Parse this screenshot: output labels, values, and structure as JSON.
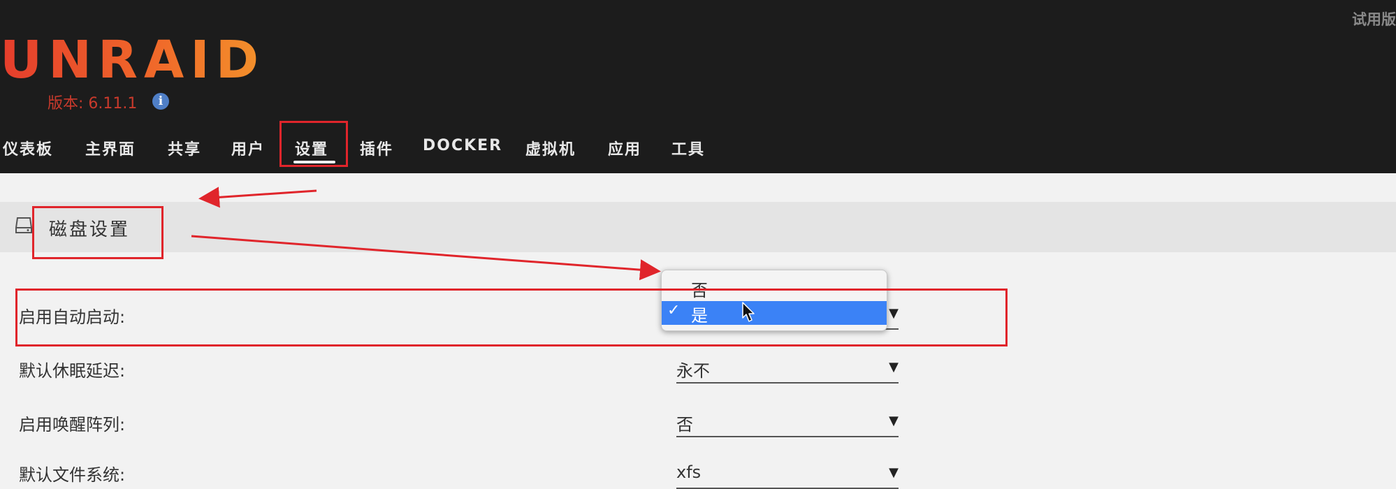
{
  "header": {
    "trial_label": "试用版",
    "logo_text": "UNRAID",
    "version": "版本: 6.11.1"
  },
  "nav": {
    "items": [
      {
        "label": "仪表板"
      },
      {
        "label": "主界面"
      },
      {
        "label": "共享"
      },
      {
        "label": "用户"
      },
      {
        "label": "设置",
        "active": true
      },
      {
        "label": "插件"
      },
      {
        "label": "DOCKER"
      },
      {
        "label": "虚拟机"
      },
      {
        "label": "应用"
      },
      {
        "label": "工具"
      }
    ]
  },
  "section": {
    "title": "磁盘设置",
    "icon": "disk-icon"
  },
  "settings": [
    {
      "label": "启用自动启动:",
      "value": "是"
    },
    {
      "label": "默认休眠延迟:",
      "value": "永不"
    },
    {
      "label": "启用唤醒阵列:",
      "value": "否"
    },
    {
      "label": "默认文件系统:",
      "value": "xfs"
    }
  ],
  "dropdown": {
    "options": [
      {
        "label": "否",
        "selected": false
      },
      {
        "label": "是",
        "selected": true
      }
    ],
    "check_mark": "✓"
  },
  "colors": {
    "header_bg": "#1c1c1c",
    "accent_orange": "#f06a2a",
    "selection_blue": "#3b82f6",
    "annotation_red": "#e0252b"
  }
}
